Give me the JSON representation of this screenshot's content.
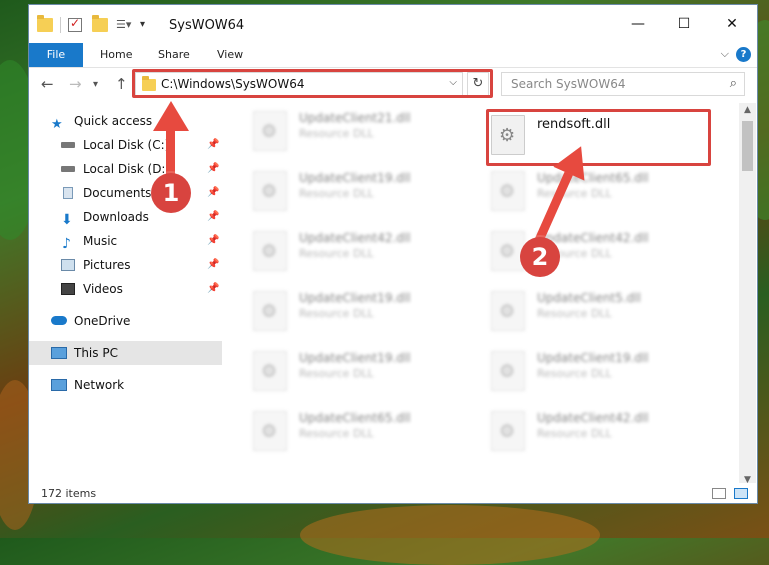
{
  "window": {
    "title": "SysWOW64",
    "controls": {
      "minimize": "—",
      "maximize": "☐",
      "close": "✕"
    }
  },
  "ribbon": {
    "tabs": [
      "File",
      "Home",
      "Share",
      "View"
    ]
  },
  "nav": {
    "back": "←",
    "forward": "→",
    "up": "↑",
    "address": "C:\\Windows\\SysWOW64",
    "dropdown": "⌵",
    "refresh": "↻",
    "search_placeholder": "Search SysWOW64",
    "search_icon": "⌕"
  },
  "sidebar": {
    "items": [
      {
        "label": "Quick access",
        "icon": "star-icon",
        "pinned": false
      },
      {
        "label": "Local Disk (C:)",
        "icon": "drive-icon",
        "pinned": true
      },
      {
        "label": "Local Disk (D:)",
        "icon": "drive-icon",
        "pinned": true
      },
      {
        "label": "Documents",
        "icon": "documents-icon",
        "pinned": true
      },
      {
        "label": "Downloads",
        "icon": "download-icon",
        "pinned": true
      },
      {
        "label": "Music",
        "icon": "music-icon",
        "pinned": true
      },
      {
        "label": "Pictures",
        "icon": "pictures-icon",
        "pinned": true
      },
      {
        "label": "Videos",
        "icon": "videos-icon",
        "pinned": true
      },
      {
        "label": "OneDrive",
        "icon": "cloud-icon",
        "pinned": false
      },
      {
        "label": "This PC",
        "icon": "computer-icon",
        "pinned": false
      },
      {
        "label": "Network",
        "icon": "network-icon",
        "pinned": false
      }
    ]
  },
  "files": {
    "left": [
      {
        "name": "UpdateClient21.dll",
        "type": "Resource DLL"
      },
      {
        "name": "UpdateClient19.dll",
        "type": "Resource DLL"
      },
      {
        "name": "UpdateClient42.dll",
        "type": "Resource DLL"
      },
      {
        "name": "UpdateClient19.dll",
        "type": "Resource DLL"
      },
      {
        "name": "UpdateClient19.dll",
        "type": "Resource DLL"
      },
      {
        "name": "UpdateClient65.dll",
        "type": "Resource DLL"
      }
    ],
    "right": [
      {
        "name": "rendsoft.dll",
        "type": ""
      },
      {
        "name": "UpdateClient65.dll",
        "type": "Resource DLL"
      },
      {
        "name": "UpdateClient42.dll",
        "type": "Resource DLL"
      },
      {
        "name": "UpdateClient5.dll",
        "type": "Resource DLL"
      },
      {
        "name": "UpdateClient19.dll",
        "type": "Resource DLL"
      },
      {
        "name": "UpdateClient42.dll",
        "type": "Resource DLL"
      }
    ]
  },
  "status": {
    "count": "172 items"
  },
  "annotations": {
    "step1": "1",
    "step2": "2",
    "color": "#d8443f"
  }
}
